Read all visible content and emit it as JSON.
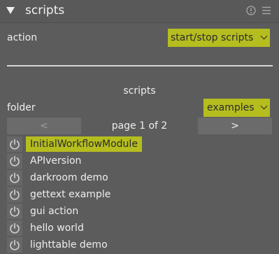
{
  "header": {
    "title": "scripts",
    "icons": [
      "expand-arrow-icon",
      "reset-icon",
      "presets-menu-icon"
    ]
  },
  "action": {
    "label": "action",
    "value": "start/stop scripts"
  },
  "section": {
    "label": "scripts"
  },
  "folder": {
    "label": "folder",
    "value": "examples"
  },
  "pager": {
    "prev_label": "<",
    "info": "page 1 of 2",
    "next_label": ">"
  },
  "scripts": [
    {
      "name": "InitialWorkflowModule",
      "highlighted": true
    },
    {
      "name": "APIversion"
    },
    {
      "name": "darkroom demo"
    },
    {
      "name": "gettext example"
    },
    {
      "name": "gui action"
    },
    {
      "name": "hello world"
    },
    {
      "name": "lighttable demo"
    }
  ],
  "colors": {
    "panel_bg": "#5c5c5c",
    "accent": "#b5bd1f",
    "text": "#eeeeee"
  }
}
